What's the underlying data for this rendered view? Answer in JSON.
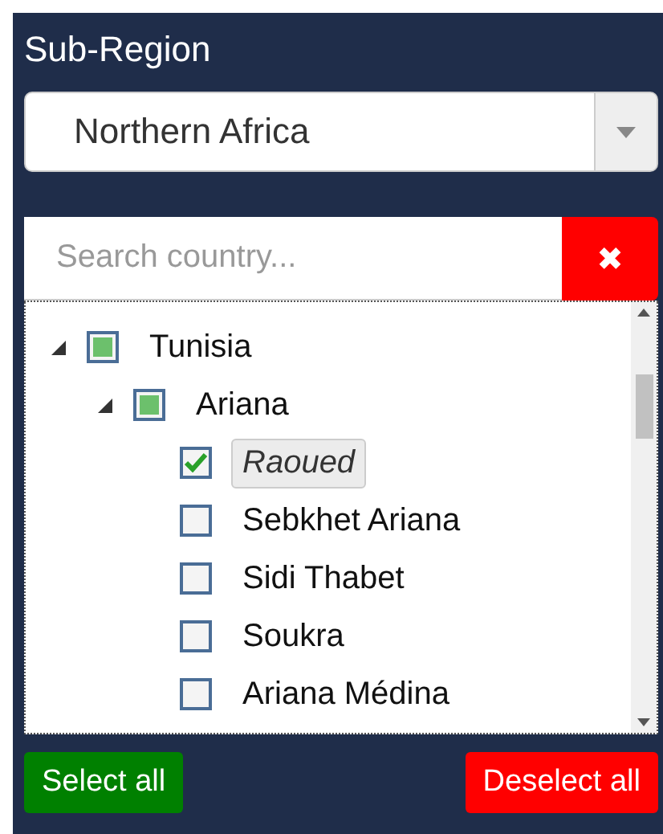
{
  "title": "Sub-Region",
  "dropdown": {
    "value": "Northern Africa"
  },
  "search": {
    "placeholder": "Search country...",
    "clear": "✖"
  },
  "tree": [
    {
      "label": "Tunisia",
      "checked": false,
      "indeterminate": true,
      "expanded": true,
      "selected": false,
      "children": [
        {
          "label": "Ariana",
          "checked": false,
          "indeterminate": true,
          "expanded": true,
          "selected": false,
          "children": [
            {
              "label": "Raoued",
              "checked": true,
              "indeterminate": false,
              "selected": true
            },
            {
              "label": "Sebkhet Ariana",
              "checked": false,
              "indeterminate": false,
              "selected": false
            },
            {
              "label": "Sidi Thabet",
              "checked": false,
              "indeterminate": false,
              "selected": false
            },
            {
              "label": "Soukra",
              "checked": false,
              "indeterminate": false,
              "selected": false
            },
            {
              "label": "Ariana Médina",
              "checked": false,
              "indeterminate": false,
              "selected": false
            }
          ]
        }
      ]
    }
  ],
  "buttons": {
    "select_all": "Select all",
    "deselect_all": "Deselect all"
  }
}
